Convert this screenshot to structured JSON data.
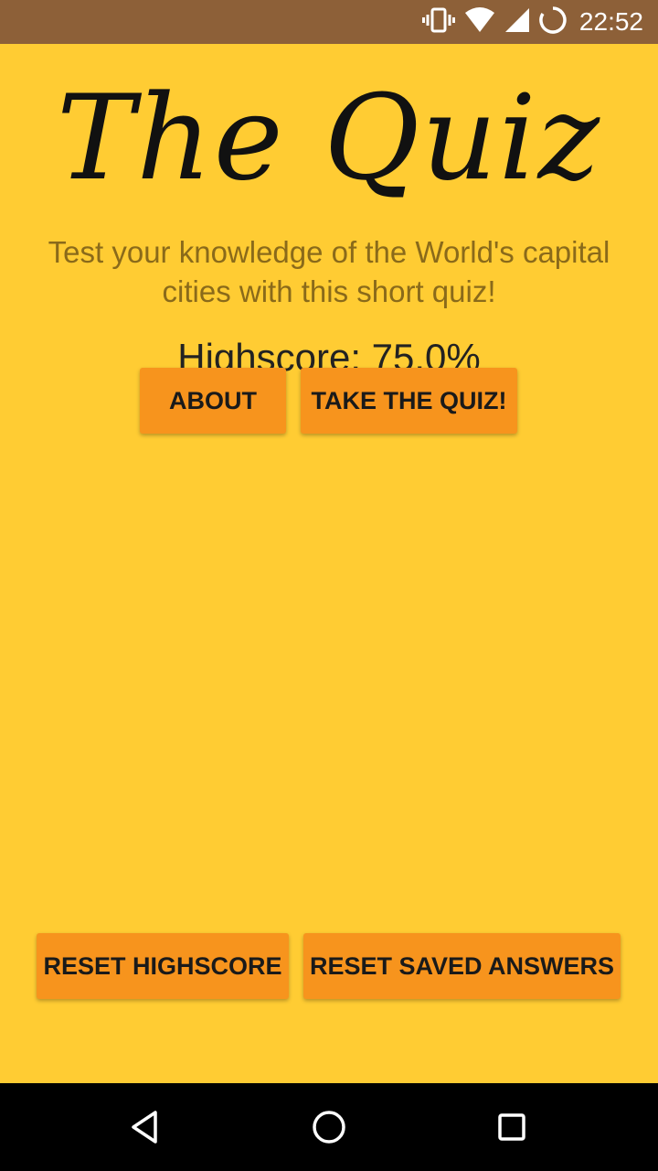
{
  "status_bar": {
    "time": "22:52",
    "icons": [
      "vibrate-icon",
      "wifi-icon",
      "signal-icon",
      "sync-icon"
    ],
    "background_color": "#8d6038"
  },
  "app": {
    "title": "The Quiz",
    "subtitle": "Test your knowledge of the World's capital cities with this short quiz!",
    "highscore": "Highscore: 75.0%",
    "background_color": "#ffcc33",
    "button_color": "#f7941d"
  },
  "buttons": {
    "about": "ABOUT",
    "take_quiz": "TAKE THE QUIZ!",
    "reset_highscore": "RESET HIGHSCORE",
    "reset_saved_answers": "RESET SAVED ANSWERS"
  },
  "nav_bar": {
    "icons": [
      "back-icon",
      "home-icon",
      "recents-icon"
    ]
  }
}
